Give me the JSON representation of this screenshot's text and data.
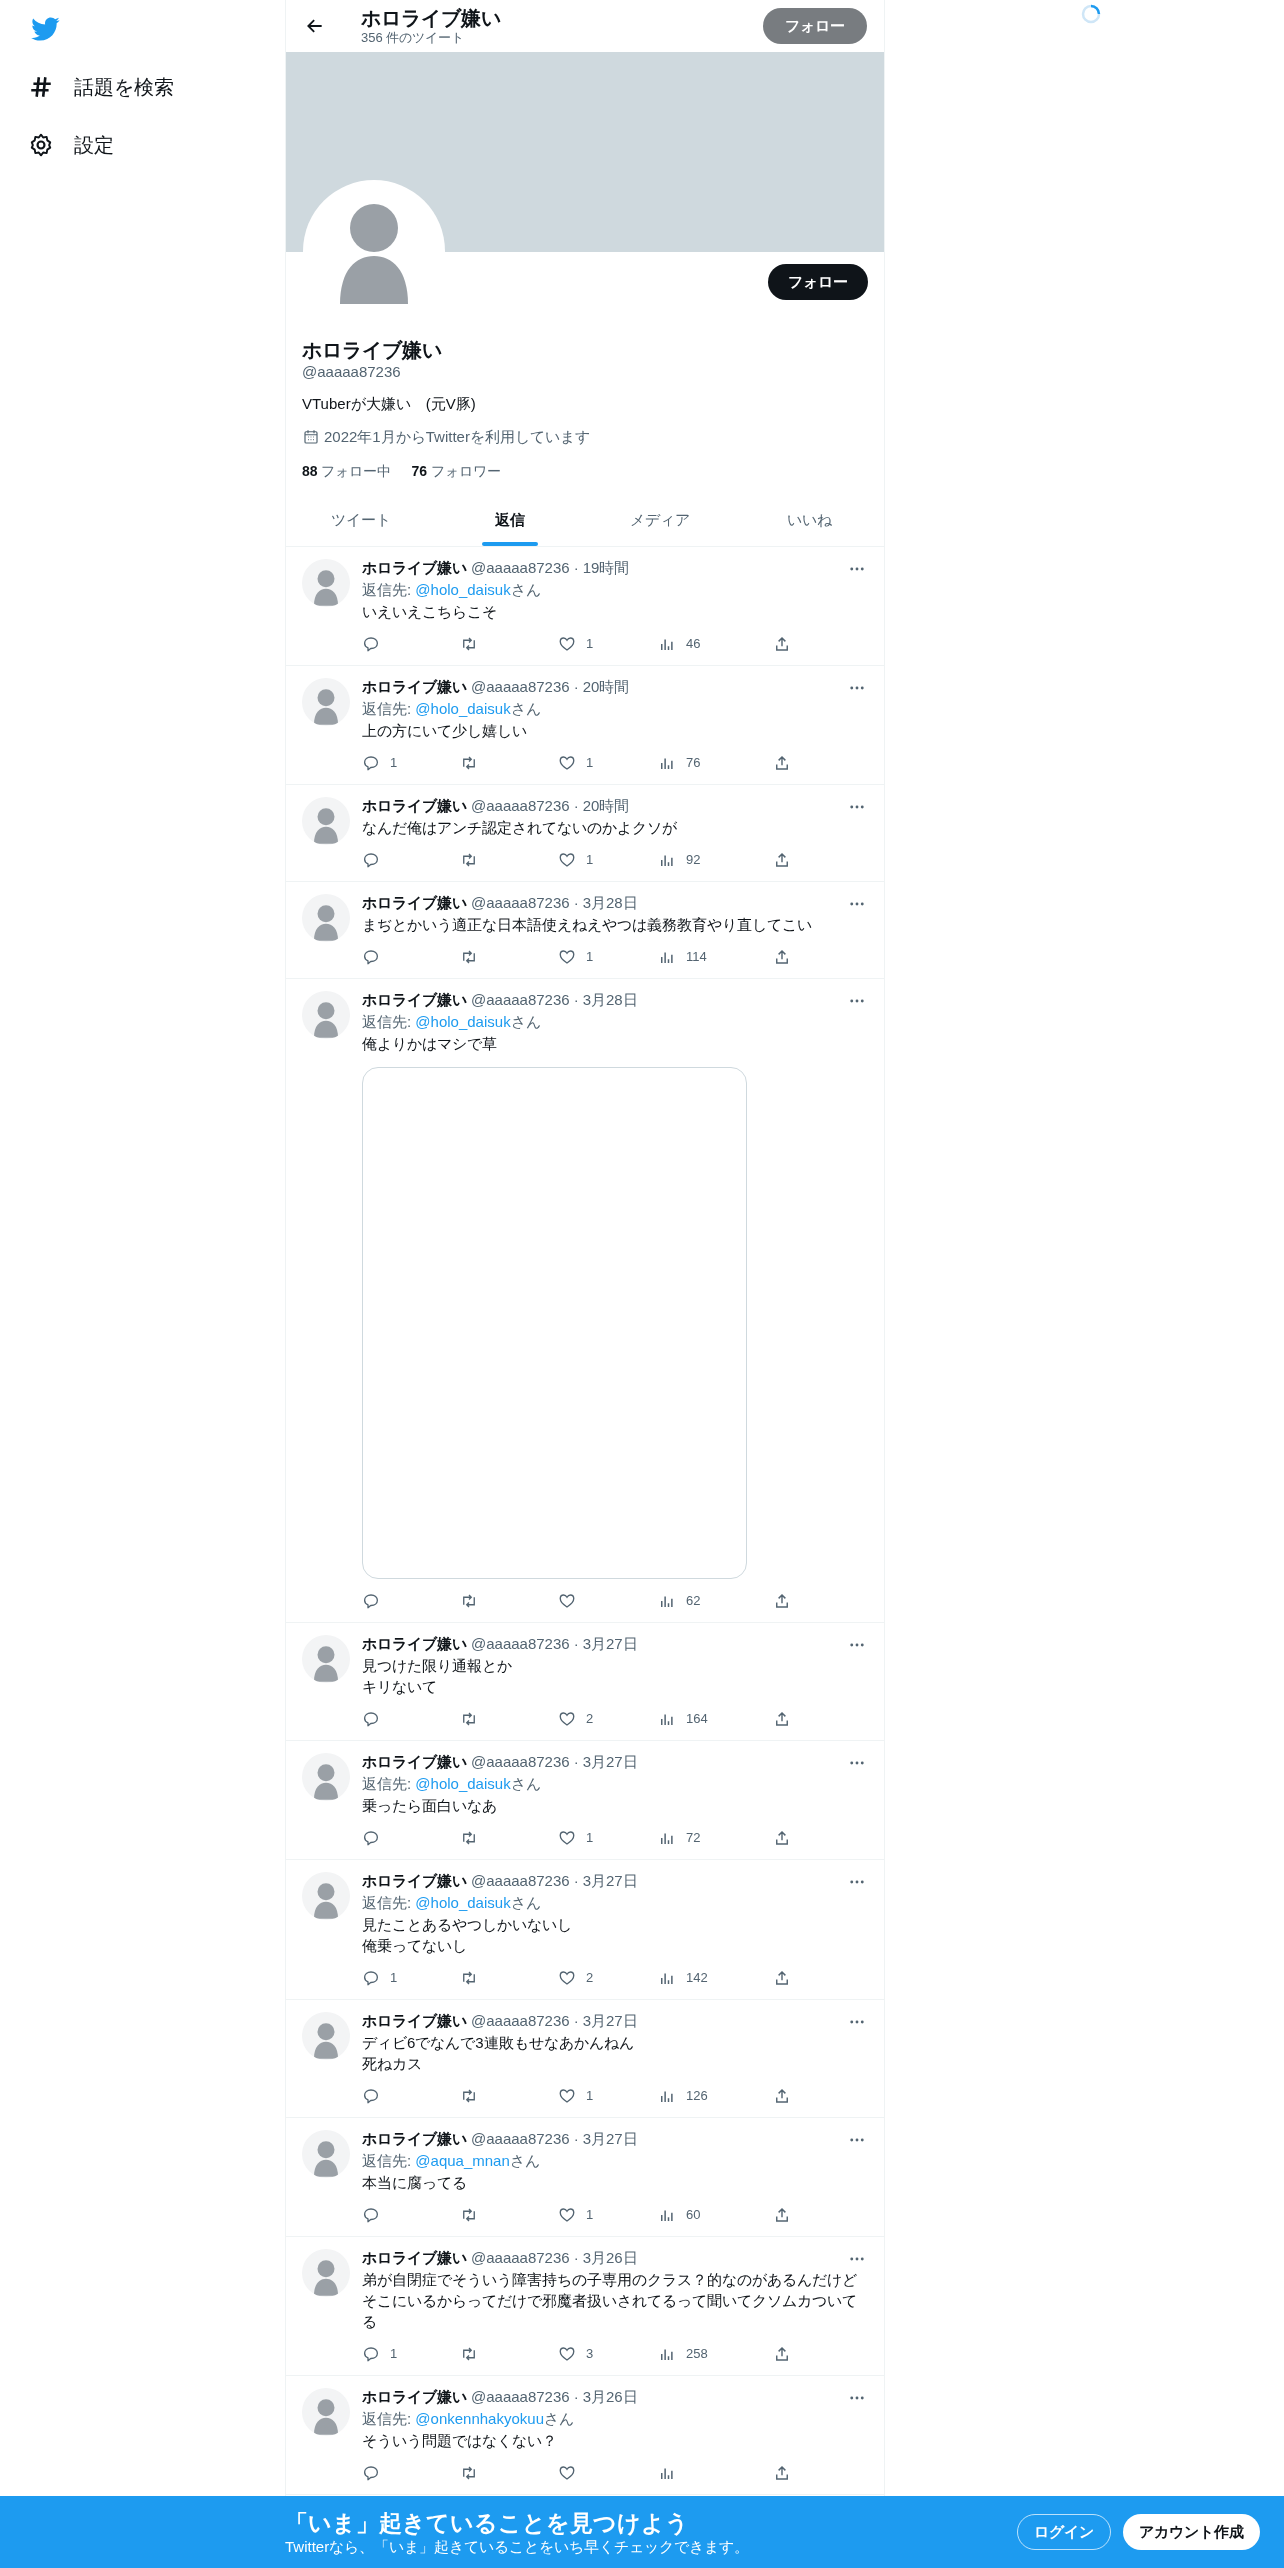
{
  "sidebar": {
    "items": [
      {
        "label": "話題を検索"
      },
      {
        "label": "設定"
      }
    ]
  },
  "header": {
    "title": "ホロライブ嫌い",
    "subtitle": "356 件のツイート",
    "follow_button": {
      "label": "フォロー",
      "kind": "muted"
    }
  },
  "profile": {
    "follow_button": {
      "label": "フォロー",
      "kind": "solid"
    },
    "name": "ホロライブ嫌い",
    "handle": "@aaaaa87236",
    "bio": "VTuberが大嫌い　(元V豚)",
    "joined": "2022年1月からTwitterを利用しています",
    "following": "**88** フォロー中",
    "followers": "**76** フォロワー"
  },
  "tabs": [
    {
      "label": "ツイート",
      "selected": false
    },
    {
      "label": "返信",
      "selected": true
    },
    {
      "label": "メディア",
      "selected": false
    },
    {
      "label": "いいね",
      "selected": false
    }
  ],
  "tweets": [
    {
      "name": "ホロライブ嫌い",
      "handle": "@aaaaa87236",
      "dot": "·",
      "time": "19時間",
      "reply_to": {
        "prefix": "返信先:",
        "handle": "@holo_daisuk",
        "suffix": "さん"
      },
      "text": "いえいえこちらこそ",
      "likes": "1",
      "views": "46"
    },
    {
      "name": "ホロライブ嫌い",
      "handle": "@aaaaa87236",
      "dot": "·",
      "time": "20時間",
      "reply_to": {
        "prefix": "返信先:",
        "handle": "@holo_daisuk",
        "suffix": "さん"
      },
      "text": "上の方にいて少し嬉しい",
      "replies": "1",
      "likes": "1",
      "views": "76"
    },
    {
      "name": "ホロライブ嫌い",
      "handle": "@aaaaa87236",
      "dot": "·",
      "time": "20時間",
      "text": "なんだ俺はアンチ認定されてないのかよクソが",
      "likes": "1",
      "views": "92"
    },
    {
      "name": "ホロライブ嫌い",
      "handle": "@aaaaa87236",
      "dot": "·",
      "time": "3月28日",
      "text": "まぢとかいう適正な日本語使えねえやつは義務教育やり直してこい",
      "likes": "1",
      "views": "114"
    },
    {
      "name": "ホロライブ嫌い",
      "handle": "@aaaaa87236",
      "dot": "·",
      "time": "3月28日",
      "reply_to": {
        "prefix": "返信先:",
        "handle": "@holo_daisuk",
        "suffix": "さん"
      },
      "text": "俺よりかはマシで草",
      "media_card": true,
      "views": "62"
    },
    {
      "name": "ホロライブ嫌い",
      "handle": "@aaaaa87236",
      "dot": "·",
      "time": "3月27日",
      "lines": [
        "見つけた限り通報とか",
        "キリないて"
      ],
      "likes": "2",
      "views": "164"
    },
    {
      "name": "ホロライブ嫌い",
      "handle": "@aaaaa87236",
      "dot": "·",
      "time": "3月27日",
      "reply_to": {
        "prefix": "返信先:",
        "handle": "@holo_daisuk",
        "suffix": "さん"
      },
      "text": "乗ったら面白いなあ",
      "likes": "1",
      "views": "72"
    },
    {
      "name": "ホロライブ嫌い",
      "handle": "@aaaaa87236",
      "dot": "·",
      "time": "3月27日",
      "reply_to": {
        "prefix": "返信先:",
        "handle": "@holo_daisuk",
        "suffix": "さん"
      },
      "lines": [
        "見たことあるやつしかいないし",
        "俺乗ってないし"
      ],
      "replies": "1",
      "likes": "2",
      "views": "142"
    },
    {
      "name": "ホロライブ嫌い",
      "handle": "@aaaaa87236",
      "dot": "·",
      "time": "3月27日",
      "lines": [
        "ディビ6でなんで3連敗もせなあかんねん",
        "死ねカス"
      ],
      "likes": "1",
      "views": "126"
    },
    {
      "name": "ホロライブ嫌い",
      "handle": "@aaaaa87236",
      "dot": "·",
      "time": "3月27日",
      "reply_to": {
        "prefix": "返信先:",
        "handle": "@aqua_mnan",
        "suffix": "さん"
      },
      "text": "本当に腐ってる",
      "likes": "1",
      "views": "60"
    },
    {
      "name": "ホロライブ嫌い",
      "handle": "@aaaaa87236",
      "dot": "·",
      "time": "3月26日",
      "text": "弟が自閉症でそういう障害持ちの子専用のクラス？的なのがあるんだけどそこにいるからってだけで邪魔者扱いされてるって聞いてクソムカついてる",
      "replies": "1",
      "likes": "3",
      "views": "258"
    },
    {
      "name": "ホロライブ嫌い",
      "handle": "@aaaaa87236",
      "dot": "·",
      "time": "3月26日",
      "reply_to": {
        "prefix": "返信先:",
        "handle": "@onkennhakyokuu",
        "suffix": "さん"
      },
      "text": "そういう問題ではなくない？"
    }
  ],
  "signup_banner": {
    "title": "「いま」起きていることを見つけよう",
    "subtitle": "Twitterなら、「いま」起きていることをいち早くチェックできます。",
    "buttons": [
      {
        "label": "ログイン",
        "kind": "outline"
      },
      {
        "label": "アカウント作成",
        "kind": "filled"
      }
    ]
  }
}
